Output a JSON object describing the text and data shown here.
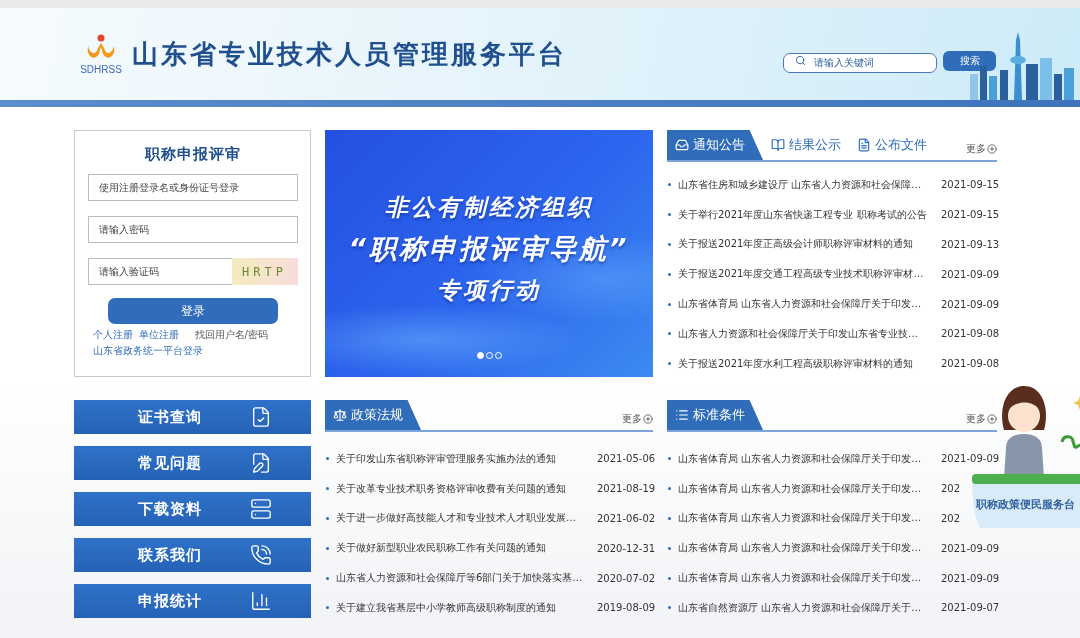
{
  "header": {
    "logo_text": "SDHRSS",
    "title": "山东省专业技术人员管理服务平台",
    "search": {
      "placeholder": "请输入关键词"
    },
    "search_button": "搜索"
  },
  "login": {
    "title": "职称申报评审",
    "username": {
      "placeholder": "使用注册登录名或身份证号登录"
    },
    "password": {
      "placeholder": "请输入密码"
    },
    "captcha": {
      "placeholder": "请输入验证码"
    },
    "captcha_image": "HRTP",
    "login_button": "登录",
    "links": [
      {
        "text": "个人注册",
        "kind": "primary"
      },
      {
        "text": "单位注册",
        "kind": "primary"
      },
      {
        "text": "找回用户名/密码",
        "kind": "secondary"
      },
      {
        "text": "山东省政务统一平台登录",
        "kind": "primary"
      }
    ]
  },
  "banner": {
    "lines": [
      "非公有制经济组织",
      "“职称申报评审导航”",
      "专项行动"
    ],
    "dots": [
      {
        "selected": true
      },
      {
        "selected": false
      },
      {
        "selected": false
      }
    ]
  },
  "notices": {
    "tabs": [
      {
        "label": "通知公告",
        "kind": "tray",
        "selected": true
      },
      {
        "label": "结果公示",
        "kind": "book",
        "selected": false
      },
      {
        "label": "公布文件",
        "kind": "file",
        "selected": false
      }
    ],
    "more": "更多",
    "items": [
      {
        "title": "山东省住房和城乡建设厅 山东省人力资源和社会保障…",
        "date": "2021-09-15"
      },
      {
        "title": "关于举行2021年度山东省快递工程专业 职称考试的公告",
        "date": "2021-09-15"
      },
      {
        "title": "关于报送2021年度正高级会计师职称评审材料的通知",
        "date": "2021-09-13"
      },
      {
        "title": "关于报送2021年度交通工程高级专业技术职称评审材…",
        "date": "2021-09-09"
      },
      {
        "title": "山东省体育局 山东省人力资源和社会保障厅关于印发…",
        "date": "2021-09-09"
      },
      {
        "title": "山东省人力资源和社会保障厅关于印发山东省专业技…",
        "date": "2021-09-08"
      },
      {
        "title": "关于报送2021年度水利工程高级职称评审材料的通知",
        "date": "2021-09-08"
      }
    ]
  },
  "quick_links": [
    {
      "label": "证书查询",
      "kind": "certificate"
    },
    {
      "label": "常见问题",
      "kind": "question"
    },
    {
      "label": "下载资料",
      "kind": "download"
    },
    {
      "label": "联系我们",
      "kind": "phone"
    },
    {
      "label": "申报统计",
      "kind": "chart"
    }
  ],
  "policies": {
    "title": "政策法规",
    "kind": "scale",
    "more": "更多",
    "items": [
      {
        "title": "关于印发山东省职称评审管理服务实施办法的通知",
        "date": "2021-05-06"
      },
      {
        "title": "关于改革专业技术职务资格评审收费有关问题的通知",
        "date": "2021-08-19"
      },
      {
        "title": "关于进一步做好高技能人才和专业技术人才职业发展…",
        "date": "2021-06-02"
      },
      {
        "title": "关于做好新型职业农民职称工作有关问题的通知",
        "date": "2020-12-31"
      },
      {
        "title": "山东省人力资源和社会保障厅等6部门关于加快落实基…",
        "date": "2020-07-02"
      },
      {
        "title": "关于建立我省基层中小学教师高级职称制度的通知",
        "date": "2019-08-09"
      }
    ]
  },
  "standards": {
    "title": "标准条件",
    "kind": "list",
    "more": "更多",
    "items": [
      {
        "title": "山东省体育局 山东省人力资源和社会保障厅关于印发…",
        "date": "2021-09-09"
      },
      {
        "title": "山东省体育局 山东省人力资源和社会保障厅关于印发…",
        "date": "202"
      },
      {
        "title": "山东省体育局 山东省人力资源和社会保障厅关于印发…",
        "date": "202"
      },
      {
        "title": "山东省体育局 山东省人力资源和社会保障厅关于印发…",
        "date": "2021-09-09"
      },
      {
        "title": "山东省体育局 山东省人力资源和社会保障厅关于印发…",
        "date": "2021-09-09"
      },
      {
        "title": "山东省自然资源厅 山东省人力资源和社会保障厅关于…",
        "date": "2021-09-07"
      }
    ]
  },
  "service_desk": {
    "label": "职称政策便民服务台"
  }
}
